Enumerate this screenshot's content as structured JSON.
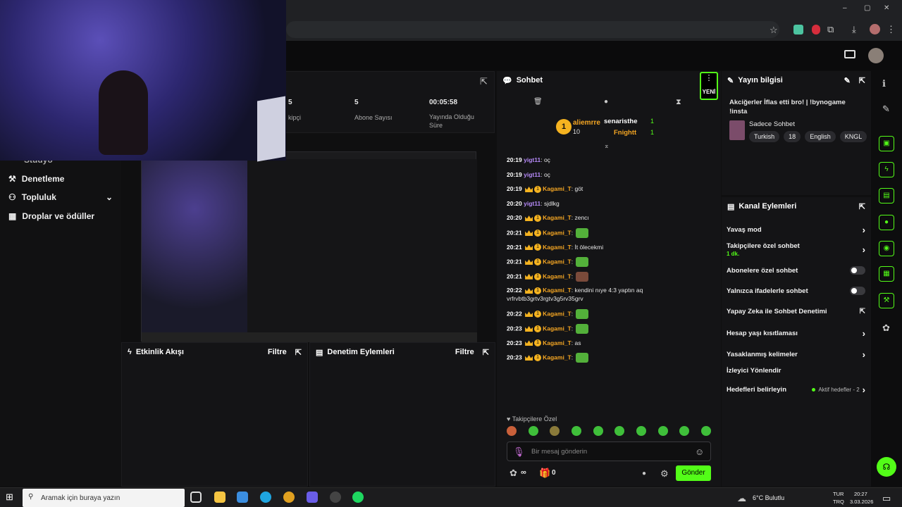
{
  "stats": {
    "followers_label_partial": "kipçi",
    "followers_value": "5",
    "subs_value": "5",
    "subs_label": "Abone Sayısı",
    "duration_value": "00:05:58",
    "duration_label": "Yayında Olduğu Süre"
  },
  "sidebar": {
    "items": [
      {
        "label": "Denetleme",
        "icon": "hammer-icon"
      },
      {
        "label": "Topluluk",
        "icon": "people-icon"
      },
      {
        "label": "Droplar ve ödüller",
        "icon": "gift-icon"
      }
    ],
    "partial_label": "Stüdyo"
  },
  "activity": {
    "title": "Etkinlik Akışı",
    "filter": "Filtre"
  },
  "moderation": {
    "title": "Denetim Eylemleri",
    "filter": "Filtre"
  },
  "chat": {
    "title": "Sohbet",
    "new_label": "YENİ",
    "leaderboard": [
      {
        "rank": "1",
        "name": "aliemrre",
        "count": "10"
      },
      {
        "name": "senaristhe",
        "count": "1"
      },
      {
        "name": "Fnightt",
        "count": "1"
      }
    ],
    "messages": [
      {
        "time": "20:19",
        "user": "yigt11",
        "text": ": oç",
        "style": "u1"
      },
      {
        "time": "20:19",
        "user": "yigt11",
        "text": ": oç",
        "style": "u1"
      },
      {
        "time": "20:19",
        "user": "Kagami_T",
        "text": ": göt",
        "style": "u2"
      },
      {
        "time": "20:20",
        "user": "yigt11",
        "text": ": sjdlkg",
        "style": "u1"
      },
      {
        "time": "20:20",
        "user": "Kagami_T",
        "text": ": zencı",
        "style": "u2"
      },
      {
        "time": "20:21",
        "user": "Kagami_T",
        "text": ":",
        "style": "u2"
      },
      {
        "time": "20:21",
        "user": "Kagami_T",
        "text": ": İt ölecekmi",
        "style": "u2"
      },
      {
        "time": "20:21",
        "user": "Kagami_T",
        "text": ":",
        "style": "u2"
      },
      {
        "time": "20:21",
        "user": "Kagami_T",
        "text": ":",
        "style": "u2"
      },
      {
        "time": "20:22",
        "user": "Kagami_T",
        "text": ": kendini nıye 4:3 yaptın aq vrfrvbtb3grtv3rgtv3g5rv35grv",
        "style": "u2"
      },
      {
        "time": "20:22",
        "user": "Kagami_T",
        "text": ":",
        "style": "u2"
      },
      {
        "time": "20:23",
        "user": "Kagami_T",
        "text": ":",
        "style": "u2"
      },
      {
        "time": "20:23",
        "user": "Kagami_T",
        "text": ": as",
        "style": "u2"
      },
      {
        "time": "20:23",
        "user": "Kagami_T",
        "text": ":",
        "style": "u2"
      }
    ],
    "followers_only": "Takipçilere Özel",
    "input_placeholder": "Bir mesaj gönderin",
    "points": "∞",
    "gifts": "0",
    "send": "Gönder"
  },
  "info": {
    "title": "Yayın bilgisi",
    "stream_title": "Akciğerler İflas etti bro! | !bynogame !insta",
    "category": "Sadece Sohbet",
    "tags": [
      "Turkish",
      "18",
      "English",
      "KNGL"
    ]
  },
  "actions": {
    "title": "Kanal Eylemleri",
    "items": [
      {
        "label": "Yavaş mod",
        "kind": "chevron"
      },
      {
        "label": "Takipçilere özel sohbet",
        "sub": "1 dk.",
        "kind": "chevron"
      },
      {
        "label": "Abonelere özel sohbet",
        "kind": "toggle"
      },
      {
        "label": "Yalnızca ifadelerle sohbet",
        "kind": "toggle"
      },
      {
        "label": "Yapay Zeka ile Sohbet Denetimi",
        "kind": "external"
      },
      {
        "label": "Hesap yaşı kısıtlaması",
        "kind": "chevron"
      },
      {
        "label": "Yasaklanmış kelimeler",
        "kind": "chevron"
      },
      {
        "label": "İzleyici Yönlendir",
        "kind": "none"
      },
      {
        "label": "Hedefleri belirleyin",
        "note": "Aktif hedefler - 2",
        "kind": "chevron"
      }
    ]
  },
  "taskbar": {
    "search_placeholder": "Aramak için buraya yazın",
    "weather": "6°C Bulutlu",
    "lang": "TUR",
    "lang2": "TRQ",
    "time": "20:27",
    "date": "3.03.2026"
  },
  "colors": {
    "accent": "#53fc18",
    "gold": "#f5b320",
    "purple": "#b589f7",
    "orange": "#f5a623"
  }
}
